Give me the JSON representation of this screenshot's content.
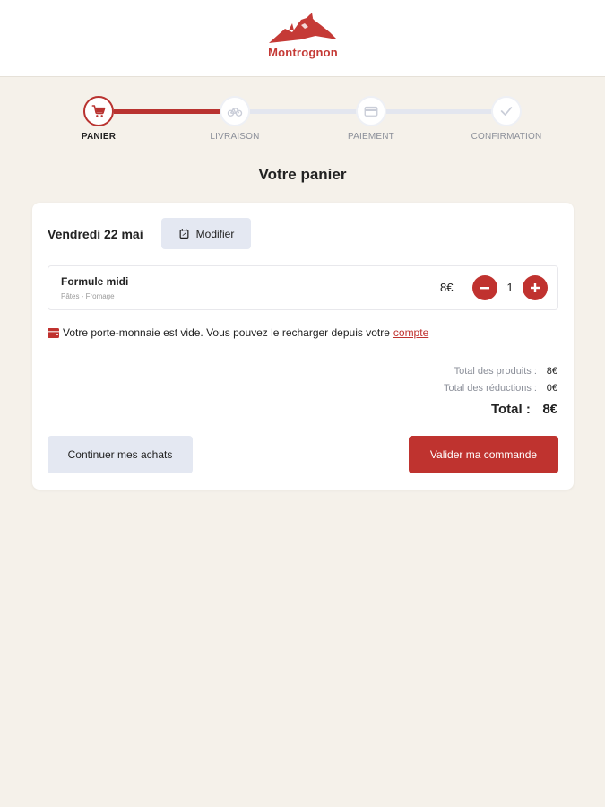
{
  "header": {
    "brand": "Montrognon"
  },
  "steps": [
    {
      "label": "PANIER",
      "state": "active"
    },
    {
      "label": "LIVRAISON",
      "state": "pending"
    },
    {
      "label": "PAIEMENT",
      "state": "pending"
    },
    {
      "label": "CONFIRMATION",
      "state": "pending"
    }
  ],
  "page_title": "Votre panier",
  "cart": {
    "date": "Vendredi 22 mai",
    "modify_label": "Modifier",
    "items": [
      {
        "name": "Formule midi",
        "detail": "Pâtes - Fromage",
        "price": "8€",
        "quantity": "1"
      }
    ],
    "wallet_message": "Votre porte-monnaie est vide. Vous pouvez le recharger depuis votre",
    "wallet_link": "compte",
    "totals": {
      "products_label": "Total des produits :",
      "products_value": "8€",
      "discounts_label": "Total des réductions :",
      "discounts_value": "0€",
      "total_label": "Total :",
      "total_value": "8€"
    },
    "continue_label": "Continuer mes achats",
    "validate_label": "Valider ma commande"
  },
  "colors": {
    "accent": "#bf332f",
    "background": "#f5f1ea",
    "secondary_button": "#e4e8f2"
  }
}
